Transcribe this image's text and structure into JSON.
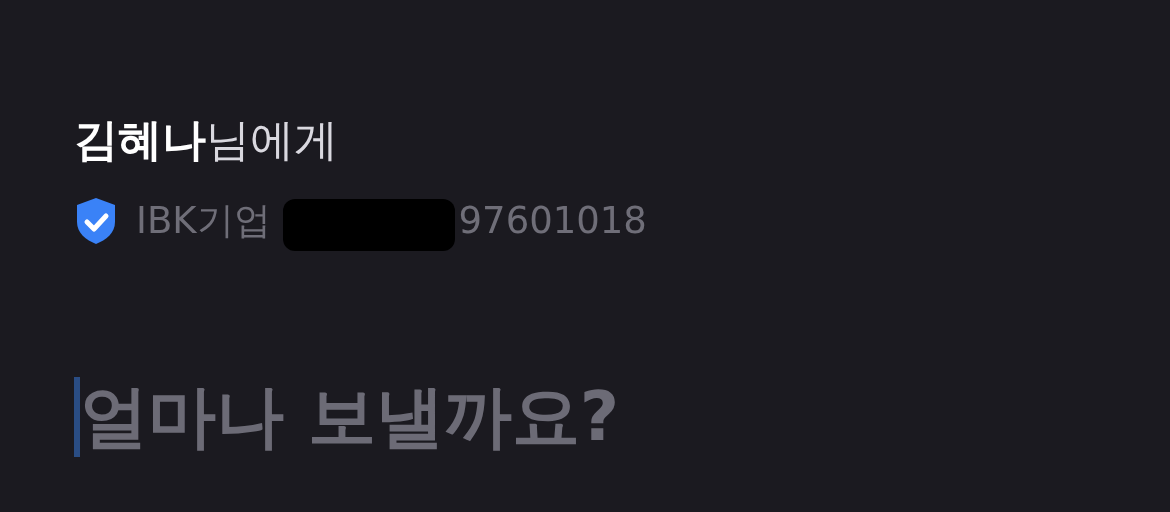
{
  "recipient": {
    "text": "**김혜나**님에게"
  },
  "account": {
    "verified": true,
    "bank": "IBK기업",
    "number_visible": "97601018"
  },
  "amount_field": {
    "placeholder": "얼마나 보낼까요?",
    "focused": true
  }
}
